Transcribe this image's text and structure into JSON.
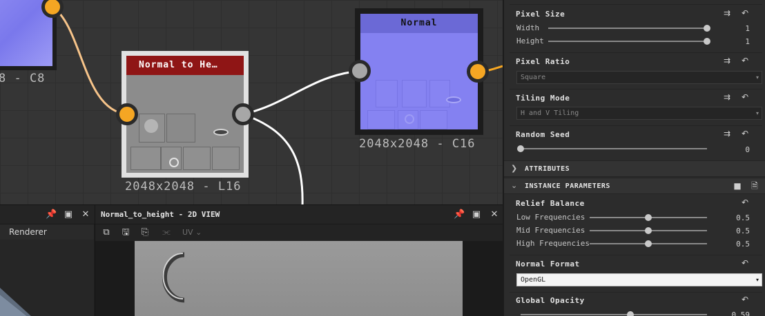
{
  "graph": {
    "nodes": {
      "c8": {
        "label": "8 - C8"
      },
      "normal_to_height": {
        "title": "Normal to He…",
        "label": "2048x2048 - L16"
      },
      "normal": {
        "title": "Normal",
        "label": "2048x2048 - C16"
      }
    }
  },
  "renderer_panel": {
    "tab_label": "Renderer"
  },
  "view2d": {
    "title": "Normal_to_height - 2D VIEW",
    "uv_label": "UV ⌄"
  },
  "properties": {
    "pixel_size": {
      "title": "Pixel Size",
      "width": {
        "label": "Width",
        "value": "1",
        "fraction": 1.0
      },
      "height": {
        "label": "Height",
        "value": "1",
        "fraction": 1.0
      }
    },
    "pixel_ratio": {
      "title": "Pixel Ratio",
      "selected": "Square"
    },
    "tiling_mode": {
      "title": "Tiling Mode",
      "selected": "H and V Tiling"
    },
    "random_seed": {
      "title": "Random Seed",
      "value": "0",
      "fraction": 0.0
    },
    "attributes_header": "ATTRIBUTES",
    "instance_parameters_header": "INSTANCE PARAMETERS",
    "relief_balance": {
      "title": "Relief Balance",
      "low": {
        "label": "Low Frequencies",
        "value": "0.5",
        "fraction": 0.5
      },
      "mid": {
        "label": "Mid Frequencies",
        "value": "0.5",
        "fraction": 0.5
      },
      "high": {
        "label": "High Frequencies",
        "value": "0.5",
        "fraction": 0.5
      }
    },
    "normal_format": {
      "title": "Normal Format",
      "selected": "OpenGL"
    },
    "global_opacity": {
      "title": "Global Opacity",
      "value": "0.59",
      "fraction": 0.59
    }
  },
  "colors": {
    "orange_socket": "#f5a623",
    "normal_map_blue": "#8481f1",
    "node_title_red": "#8f1515"
  },
  "icons": [
    "pin-icon",
    "restore-icon",
    "close-icon",
    "link-icon",
    "reset-icon",
    "save-icon",
    "copy-icon",
    "chevron-right-icon",
    "chevron-down-icon"
  ]
}
